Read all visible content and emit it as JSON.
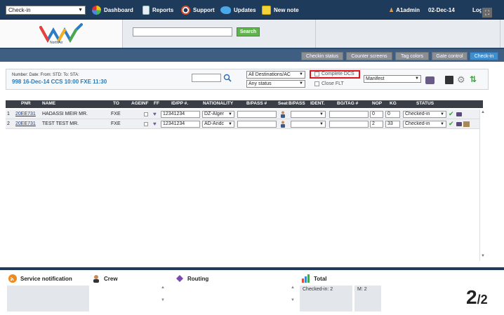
{
  "topnav": {
    "mode_select": "Check-in",
    "dashboard": "Dashboard",
    "reports": "Reports",
    "support": "Support",
    "updates": "Updates",
    "new_note": "New note",
    "user": "A1admin",
    "date": "02-Dec-14",
    "logout": "Logout"
  },
  "header": {
    "logo_text": "NorthAir",
    "search_button": "Search",
    "search_value": ""
  },
  "tabs": [
    {
      "label": "Checkin status",
      "active": false
    },
    {
      "label": "Counter screens",
      "active": false
    },
    {
      "label": "Tag colors",
      "active": false
    },
    {
      "label": "Gate control",
      "active": false
    },
    {
      "label": "Check-in",
      "active": true
    }
  ],
  "flight": {
    "labels": "Number: Date:          From: STD:    To:    STA:",
    "values": "998    16-Dec-14 CCS 10:00 FXE 11:30",
    "destinations_select": "All Destinations/AC",
    "status_select": "Any status",
    "complete_dcs": "Complete DCS",
    "close_flt": "Close FLT",
    "report_select": "Manifest"
  },
  "grid": {
    "headers": [
      "PNR",
      "NAME",
      "TO",
      "AGE",
      "INF",
      "FF",
      "ID/PP #.",
      "NATIONALITY",
      "B/PASS #",
      "Seat",
      "B/PASS",
      "IDENT.",
      "BG/TAG #",
      "NOP",
      "KG",
      "STATUS"
    ],
    "rows": [
      {
        "num": "1",
        "pnr": "20EE731",
        "name": "HADASSI MEIR MR.",
        "to": "FXE",
        "id_pp": "12341234",
        "nationality": "DZ-Alger",
        "bpass": "",
        "ident": "",
        "bgtag": "",
        "nop": "0",
        "kg": "0",
        "status": "Checked-in"
      },
      {
        "num": "2",
        "pnr": "20EE731",
        "name": "TEST TEST MR.",
        "to": "FXE",
        "id_pp": "12341234",
        "nationality": "AD-Andc",
        "bpass": "",
        "ident": "",
        "bgtag": "",
        "nop": "2",
        "kg": "33",
        "status": "Checked-in"
      }
    ]
  },
  "bottom": {
    "service_notification": "Service notification",
    "crew": "Crew",
    "routing": "Routing",
    "total": "Total",
    "checked_in": "Checked-in: 2",
    "m_count": "M: 2",
    "page_current": "2",
    "page_total": "/2"
  },
  "colors": {
    "nav_bg": "#1f3b5c",
    "tab_active": "#3d8fd0",
    "search_button": "#5fb54a",
    "highlight": "#e0141e",
    "flight_value": "#2a7ab8"
  }
}
